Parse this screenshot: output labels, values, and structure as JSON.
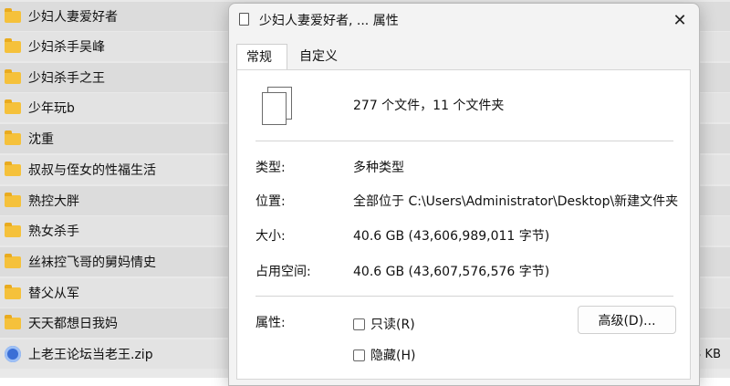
{
  "file_list": {
    "items": [
      {
        "name": "少妇人妻爱好者",
        "icon": "folder-icon"
      },
      {
        "name": "少妇杀手吴峰",
        "icon": "folder-icon"
      },
      {
        "name": "少妇杀手之王",
        "icon": "folder-icon"
      },
      {
        "name": "少年玩b",
        "icon": "folder-icon"
      },
      {
        "name": "沈重",
        "icon": "folder-icon"
      },
      {
        "name": "叔叔与侄女的性福生活",
        "icon": "folder-icon"
      },
      {
        "name": "熟控大胖",
        "icon": "folder-icon"
      },
      {
        "name": "熟女杀手",
        "icon": "folder-icon"
      },
      {
        "name": "丝袜控飞哥的舅妈情史",
        "icon": "folder-icon"
      },
      {
        "name": "替父从军",
        "icon": "folder-icon"
      },
      {
        "name": "天天都想日我妈",
        "icon": "folder-icon"
      },
      {
        "name": "上老王论坛当老王.zip",
        "icon": "zip-icon",
        "size": "3 KB"
      }
    ]
  },
  "dialog": {
    "title": "少妇人妻爱好者, ... 属性",
    "close_glyph": "✕",
    "tabs": [
      {
        "label": "常规",
        "active": true
      },
      {
        "label": "自定义",
        "active": false
      }
    ],
    "summary": "277 个文件，11 个文件夹",
    "rows": {
      "type": {
        "label": "类型:",
        "value": "多种类型"
      },
      "location": {
        "label": "位置:",
        "value": "全部位于 C:\\Users\\Administrator\\Desktop\\新建文件夹"
      },
      "size": {
        "label": "大小:",
        "value": "40.6 GB (43,606,989,011 字节)"
      },
      "size_on_disk": {
        "label": "占用空间:",
        "value": "40.6 GB (43,607,576,576 字节)"
      }
    },
    "attributes": {
      "label": "属性:",
      "readonly": {
        "label": "只读(R)",
        "checked": false
      },
      "hidden": {
        "label": "隐藏(H)",
        "checked": false
      },
      "advanced_button": "高级(D)..."
    }
  },
  "colors": {
    "folder": "#f5c13b",
    "dialog_bg": "#f3f3f3",
    "panel_bg": "#ffffff"
  }
}
